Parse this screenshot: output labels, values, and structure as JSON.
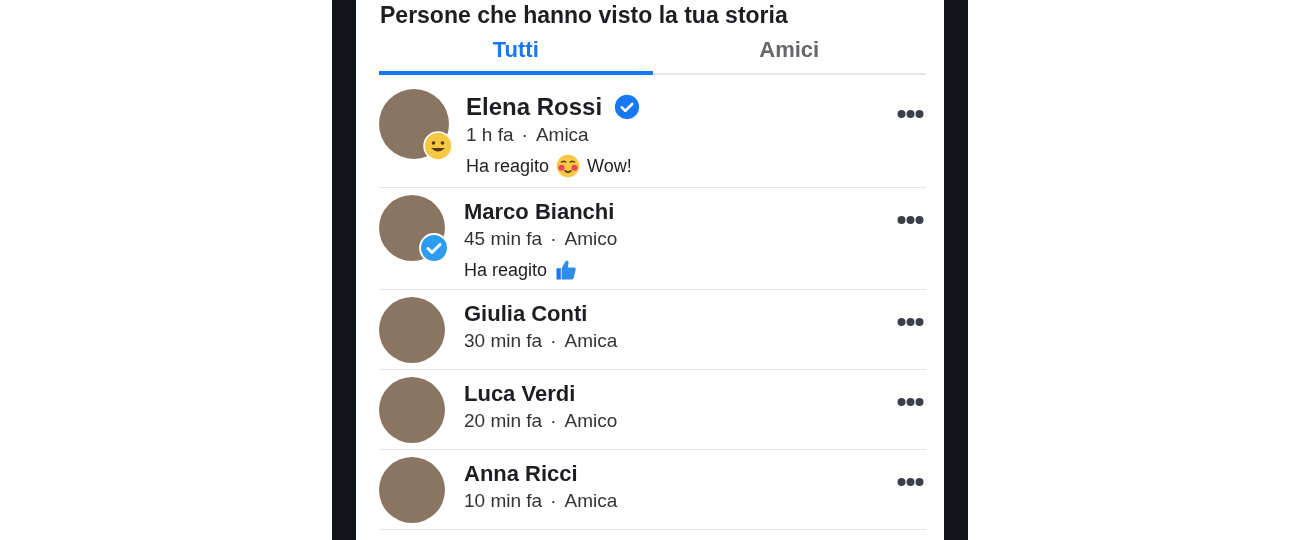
{
  "title": "Persone che hanno visto la tua storia",
  "tabs": [
    {
      "label": "Tutti",
      "selected": true
    },
    {
      "label": "Amici",
      "selected": false
    }
  ],
  "viewers": [
    {
      "name": "Elena Rossi",
      "verified": true,
      "avatar_badge": {
        "kind": "smiley"
      },
      "time": "1 h fa",
      "separator": "·",
      "relation": "Amica",
      "reaction": {
        "text": "Ha reagito",
        "kind": "wow",
        "label": "Wow!"
      }
    },
    {
      "name": "Marco Bianchi",
      "verified": false,
      "avatar_badge": {
        "kind": "verified"
      },
      "time": "45 min fa",
      "separator": "·",
      "relation": "Amico",
      "reaction": {
        "text": "Ha reagito",
        "kind": "like"
      }
    },
    {
      "name": "Giulia Conti",
      "verified": false,
      "time": "30 min fa",
      "separator": "·",
      "relation": "Amica"
    },
    {
      "name": "Luca Verdi",
      "verified": false,
      "time": "20 min fa",
      "separator": "·",
      "relation": "Amico"
    },
    {
      "name": "Anna Ricci",
      "verified": false,
      "time": "10 min fa",
      "separator": "·",
      "relation": "Amica"
    }
  ]
}
